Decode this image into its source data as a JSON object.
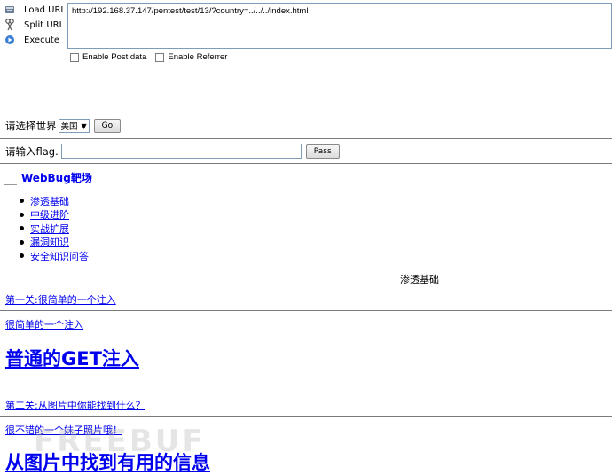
{
  "hackbar": {
    "load_url": "Load URL",
    "split_url": "Split URL",
    "execute": "Execute",
    "url_value": "http://192.168.37.147/pentest/test/13/?country=../../../index.html",
    "enable_post": "Enable Post data",
    "enable_referrer": "Enable Referrer"
  },
  "country_form": {
    "label": "请选择世界",
    "selected": "美国",
    "go": "Go"
  },
  "flag_form": {
    "label": "请输入flag.",
    "value": "",
    "pass": "Pass"
  },
  "brand": "WebBug靶场",
  "menu": [
    {
      "label": "渗透基础"
    },
    {
      "label": "中级进阶"
    },
    {
      "label": "实战扩展"
    },
    {
      "label": "漏洞知识"
    },
    {
      "label": "安全知识问答"
    }
  ],
  "section_title": "渗透基础",
  "lessons": [
    {
      "link": "第一关:很简单的一个注入",
      "desc": "很简单的一个注入",
      "heading": "普通的GET注入"
    },
    {
      "link": "第二关:从图片中你能找到什么？",
      "desc": "很不错的一个妹子照片哦！",
      "heading": "从图片中找到有用的信息"
    }
  ],
  "watermark": "FREEBUF"
}
